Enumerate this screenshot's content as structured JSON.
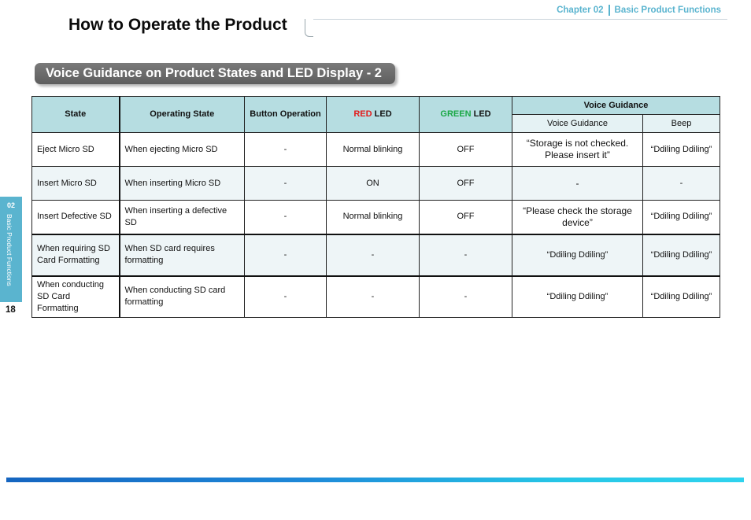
{
  "header": {
    "chapter": "Chapter 02",
    "section": "Basic Product Functions",
    "title": "How to Operate the Product"
  },
  "banner": "Voice Guidance on Product States and LED Display - 2",
  "side": {
    "num": "02",
    "label": "Basic Product Functions",
    "page": "18"
  },
  "table": {
    "headers": {
      "state": "State",
      "operating": "Operating State",
      "button": "Button Operation",
      "red_word": "RED",
      "green_word": "GREEN",
      "led_word": "LED",
      "voice_group": "Voice Guidance",
      "voice_sub": "Voice Guidance",
      "beep": "Beep"
    },
    "rows": [
      {
        "state": "Eject Micro SD",
        "operating": "When ejecting Micro SD",
        "button": "-",
        "red": "Normal blinking",
        "green": "OFF",
        "voice": "“Storage is not checked. Please insert it”",
        "beep": "“Ddiling Ddiling”"
      },
      {
        "state": "Insert Micro SD",
        "operating": "When inserting Micro SD",
        "button": "-",
        "red": "ON",
        "green": "OFF",
        "voice": "-",
        "beep": "-"
      },
      {
        "state": "Insert Defective SD",
        "operating": "When inserting a defective SD",
        "button": "-",
        "red": "Normal blinking",
        "green": "OFF",
        "voice": "“Please check the storage device”",
        "beep": "“Ddiling Ddiling”"
      },
      {
        "state": "When requiring SD Card Formatting",
        "operating": "When SD card requires formatting",
        "button": "-",
        "red": "-",
        "green": "-",
        "voice": "“Ddiling Ddiling”",
        "beep": "“Ddiling Ddiling”"
      },
      {
        "state": "When conducting SD Card Formatting",
        "operating": "When conducting SD card formatting",
        "button": "-",
        "red": "-",
        "green": "-",
        "voice": "“Ddiling Ddiling”",
        "beep": "“Ddiling Ddiling”"
      }
    ]
  },
  "colors": {
    "accent": "#5ab4cf",
    "header_bg": "#b6dde1",
    "red": "#e31b1b",
    "green": "#1aa845"
  }
}
